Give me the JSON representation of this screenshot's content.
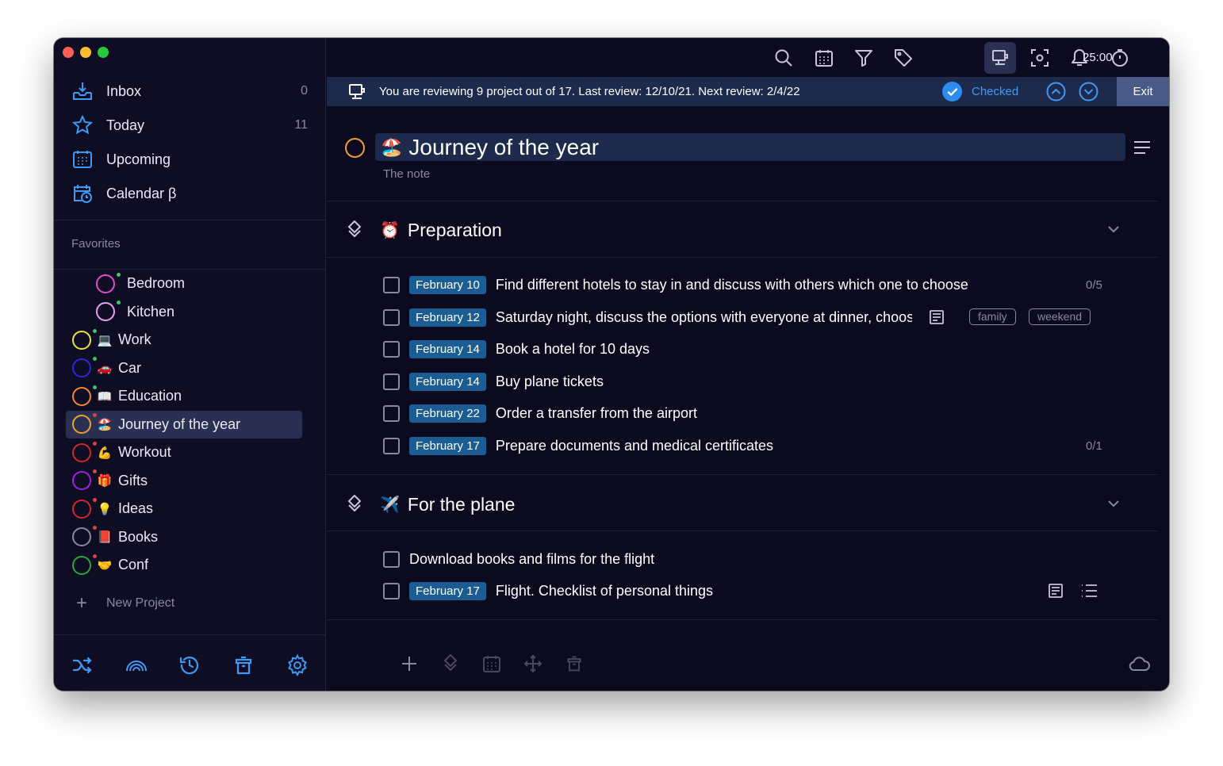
{
  "colors": {
    "accent": "#3d9bf5",
    "sidebar_bg": "#0f0d24",
    "main_bg": "#0c0a1e",
    "selected_bg": "#2a3052",
    "date_badge": "#1b5d92",
    "review_banner": "#1e2a4c"
  },
  "window": {
    "controls": [
      "close",
      "minimize",
      "zoom"
    ]
  },
  "sidebar": {
    "nav": [
      {
        "label": "Inbox",
        "count": "0",
        "icon": "inbox-icon"
      },
      {
        "label": "Today",
        "count": "11",
        "icon": "star-icon"
      },
      {
        "label": "Upcoming",
        "count": "",
        "icon": "calendar-grid-icon"
      },
      {
        "label": "Calendar β",
        "count": "",
        "icon": "calendar-clock-icon"
      }
    ],
    "favorites_label": "Favorites",
    "projects": [
      {
        "name": "Bedroom",
        "emoji": "",
        "ring": "#e04ecf",
        "dot": "#3cc46a",
        "indent": true
      },
      {
        "name": "Kitchen",
        "emoji": "",
        "ring": "#e9a0f0",
        "dot": "#3cc46a",
        "indent": true
      },
      {
        "name": "Work",
        "emoji": "💻",
        "ring": "#e9e33c",
        "dot": "#3cc46a",
        "indent": false
      },
      {
        "name": "Car",
        "emoji": "🚗",
        "ring": "#2a2ad8",
        "dot": "#3cc46a",
        "indent": false
      },
      {
        "name": "Education",
        "emoji": "📖",
        "ring": "#f08a2c",
        "dot": "#3cc46a",
        "indent": false
      },
      {
        "name": "Journey of the year",
        "emoji": "🏖️",
        "ring": "#f0a030",
        "dot": "#e04040",
        "indent": false,
        "selected": true
      },
      {
        "name": "Workout",
        "emoji": "💪",
        "ring": "#d02828",
        "dot": "#e04040",
        "indent": false
      },
      {
        "name": "Gifts",
        "emoji": "🎁",
        "ring": "#a020e0",
        "dot": "#e04040",
        "indent": false
      },
      {
        "name": "Ideas",
        "emoji": "💡",
        "ring": "#d02828",
        "dot": "#e04040",
        "indent": false
      },
      {
        "name": "Books",
        "emoji": "📕",
        "ring": "#8b89a0",
        "dot": "#e04040",
        "indent": false
      },
      {
        "name": "Conf",
        "emoji": "🤝",
        "ring": "#28a838",
        "dot": "#e04040",
        "indent": false
      }
    ],
    "new_project_label": "New Project",
    "bottom_icons": [
      "shuffle-icon",
      "rainbow-icon",
      "history-icon",
      "trash-icon",
      "gear-icon"
    ]
  },
  "toolbar": {
    "icons": [
      "search-icon",
      "calendar-icon",
      "filter-icon",
      "tag-icon",
      "review-icon",
      "focus-icon",
      "bell-icon",
      "timer-icon",
      "window-icon"
    ],
    "timer": "25:00"
  },
  "review": {
    "text": "You are reviewing 9 project out of 17. Last review: 12/10/21. Next review: 2/4/22",
    "checked_label": "Checked",
    "exit_label": "Exit"
  },
  "project": {
    "emoji": "🏖️",
    "title": "Journey of the year",
    "note": "The note"
  },
  "sections": [
    {
      "emoji": "⏰",
      "name": "Preparation",
      "tasks": [
        {
          "date": "February 10",
          "title": "Find different hotels to stay in and discuss with others which one to choose",
          "progress": "0/5"
        },
        {
          "date": "February 12",
          "title": "Saturday night, discuss the options with everyone at dinner, choose",
          "tags": [
            "family",
            "weekend"
          ],
          "has_note": true
        },
        {
          "date": "February 14",
          "title": "Book a hotel for 10 days"
        },
        {
          "date": "February 14",
          "title": "Buy plane tickets"
        },
        {
          "date": "February 22",
          "title": "Order a transfer from the airport"
        },
        {
          "date": "February 17",
          "title": "Prepare documents and medical certificates",
          "progress": "0/1"
        }
      ]
    },
    {
      "emoji": "✈️",
      "name": "For the plane",
      "tasks": [
        {
          "date": "",
          "title": "Download books and films for the flight"
        },
        {
          "date": "February 17",
          "title": "Flight. Checklist of personal things",
          "has_note": true,
          "has_checklist": true
        }
      ]
    }
  ],
  "bottom_bar": {
    "icons": [
      "add-icon",
      "section-icon",
      "calendar-icon",
      "move-icon",
      "trash-icon",
      "cloud-icon"
    ]
  }
}
